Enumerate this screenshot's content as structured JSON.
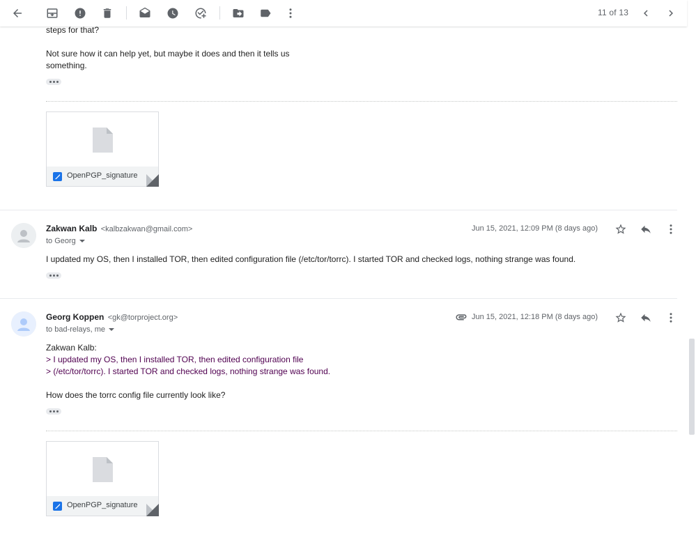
{
  "toolbar": {
    "back": "back-arrow-icon",
    "archive": "archive-icon",
    "spam": "report-spam-icon",
    "delete": "delete-icon",
    "mark_unread": "mark-unread-icon",
    "snooze": "snooze-icon",
    "add_task": "add-to-tasks-icon",
    "move": "move-to-icon",
    "label": "label-icon",
    "more": "more-vert-icon",
    "pager": "11 of 13",
    "prev": "chevron-left-icon",
    "next": "chevron-right-icon"
  },
  "top_message": {
    "line_partial": "steps for that?",
    "para_line1": "Not sure how it can help yet, but maybe it does and then it tells us",
    "para_line2": "something.",
    "attachment": {
      "filename": "OpenPGP_signature"
    }
  },
  "message_zakwan": {
    "sender_name": "Zakwan Kalb",
    "sender_email": "<kalbzakwan@gmail.com>",
    "to": "to Georg",
    "date": "Jun 15, 2021, 12:09 PM (8 days ago)",
    "body": "I updated my OS, then I installed TOR, then edited configuration file (/etc/tor/torrc). I started TOR and checked logs, nothing strange was found."
  },
  "message_georg": {
    "sender_name": "Georg Koppen",
    "sender_email": "<gk@torproject.org>",
    "to": "to bad-relays, me",
    "date": "Jun 15, 2021, 12:18 PM (8 days ago)",
    "greeting": "Zakwan Kalb:",
    "quote_line1": "> I updated my OS, then I installed TOR, then edited configuration file",
    "quote_line2": "> (/etc/tor/torrc). I started TOR and checked logs, nothing strange was found.",
    "question": "How does the torrc config file currently look like?",
    "attachment": {
      "filename": "OpenPGP_signature"
    }
  }
}
